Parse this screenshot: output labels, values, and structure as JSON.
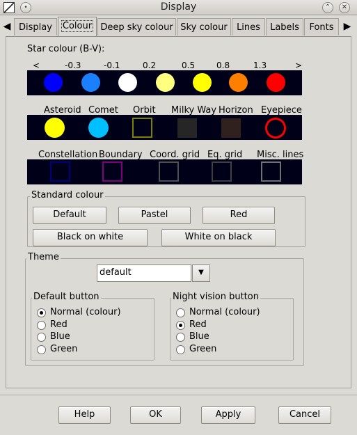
{
  "window": {
    "title": "Display",
    "menu_glyph": "•",
    "shade_glyph": "⌃",
    "close_glyph": "✕"
  },
  "tabs": [
    "Display",
    "Colour",
    "Deep sky colour",
    "Sky colour",
    "Lines",
    "Labels",
    "Fonts"
  ],
  "active_tab": "Colour",
  "star_colour": {
    "title": "Star colour (B-V):",
    "ticks": [
      "<",
      "-0.3",
      "-0.1",
      "0.2",
      "0.5",
      "0.8",
      "1.3",
      ">"
    ],
    "dots": [
      {
        "name": "blue",
        "color": "#0000ff"
      },
      {
        "name": "light-blue",
        "color": "#1a80ff"
      },
      {
        "name": "white",
        "color": "#ffffff"
      },
      {
        "name": "pale-yellow",
        "color": "#ffff80"
      },
      {
        "name": "yellow",
        "color": "#ffff00"
      },
      {
        "name": "orange",
        "color": "#ff7f00"
      },
      {
        "name": "red",
        "color": "#ff0000"
      }
    ]
  },
  "objects": {
    "labels": [
      "Asteroid",
      "Comet",
      "Orbit",
      "Milky Way",
      "Horizon",
      "Eyepiece"
    ],
    "colors": [
      "#ffff00",
      "#00bfff",
      "#808000",
      "#262626",
      "#30201e",
      "#ff0000"
    ]
  },
  "lines": {
    "labels": [
      "Constellation",
      "Boundary",
      "Coord. grid",
      "Eq. grid",
      "Misc. lines"
    ],
    "colors": [
      "#000080",
      "#800080",
      "#505050",
      "#404040",
      "#707070"
    ]
  },
  "standard_colour": {
    "title": "Standard  colour",
    "buttons": [
      "Default",
      "Pastel",
      "Red",
      "Black on white",
      "White on black"
    ]
  },
  "theme": {
    "title": "Theme",
    "selected": "default",
    "arrow": "▼"
  },
  "default_button": {
    "title": "Default button",
    "options": [
      "Normal (colour)",
      "Red",
      "Blue",
      "Green"
    ],
    "selected": "Normal (colour)"
  },
  "night_button": {
    "title": "Night vision button",
    "options": [
      "Normal (colour)",
      "Red",
      "Blue",
      "Green"
    ],
    "selected": "Red"
  },
  "footer": {
    "help": "Help",
    "ok": "OK",
    "apply": "Apply",
    "cancel": "Cancel"
  }
}
